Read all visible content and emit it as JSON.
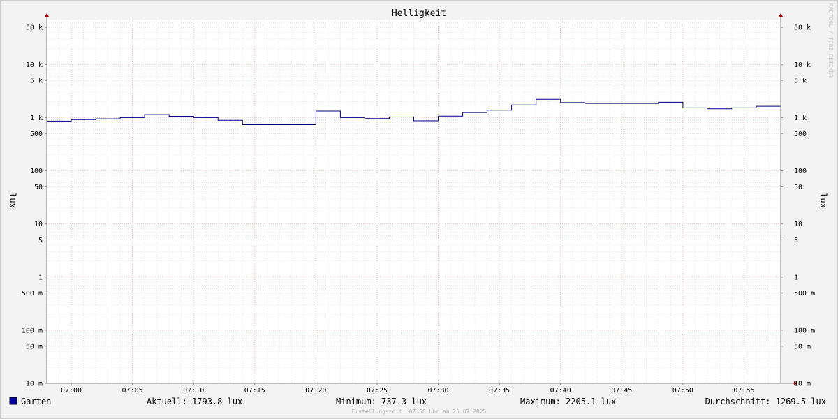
{
  "chart_data": {
    "type": "line",
    "title": "Helligkeit",
    "ylabel": "lux",
    "ylabel_right": "lux",
    "yscale": "log",
    "ylim": [
      0.01,
      70000
    ],
    "xlim": [
      "06:58",
      "07:58"
    ],
    "grid": true,
    "y_ticks": [
      {
        "value": 50000,
        "label": "50 k"
      },
      {
        "value": 10000,
        "label": "10 k"
      },
      {
        "value": 5000,
        "label": "5 k"
      },
      {
        "value": 1000,
        "label": "1 k"
      },
      {
        "value": 500,
        "label": "500"
      },
      {
        "value": 100,
        "label": "100"
      },
      {
        "value": 50,
        "label": "50"
      },
      {
        "value": 10,
        "label": "10"
      },
      {
        "value": 5,
        "label": "5"
      },
      {
        "value": 1,
        "label": "1"
      },
      {
        "value": 0.5,
        "label": "500 m"
      },
      {
        "value": 0.1,
        "label": "100 m"
      },
      {
        "value": 0.05,
        "label": "50 m"
      },
      {
        "value": 0.01,
        "label": "10 m"
      }
    ],
    "x_ticks": [
      "07:00",
      "07:05",
      "07:10",
      "07:15",
      "07:20",
      "07:25",
      "07:30",
      "07:35",
      "07:40",
      "07:45",
      "07:50",
      "07:55"
    ],
    "series": [
      {
        "name": "Garten",
        "color": "#000080",
        "x": [
          "06:58",
          "07:00",
          "07:02",
          "07:04",
          "07:06",
          "07:08",
          "07:10",
          "07:12",
          "07:14",
          "07:16",
          "07:18",
          "07:20",
          "07:22",
          "07:24",
          "07:26",
          "07:28",
          "07:30",
          "07:32",
          "07:34",
          "07:36",
          "07:38",
          "07:40",
          "07:42",
          "07:44",
          "07:46",
          "07:48",
          "07:50",
          "07:52",
          "07:54",
          "07:56"
        ],
        "values": [
          860,
          920,
          950,
          1000,
          1140,
          1060,
          1000,
          890,
          737.3,
          737.3,
          737.3,
          1330,
          1000,
          960,
          1030,
          870,
          1070,
          1250,
          1380,
          1730,
          2205.1,
          1920,
          1850,
          1850,
          1850,
          1950,
          1530,
          1470,
          1530,
          1640
        ],
        "last_value": 1793.8
      }
    ],
    "legend_position": "bottom-left"
  },
  "legend": {
    "series_name": "Garten",
    "swatch_color": "#0000a0",
    "current": "Aktuell: 1793.8 lux",
    "minimum": "Minimum: 737.3 lux",
    "maximum": "Maximum: 2205.1 lux",
    "average": "Durchschnitt: 1269.5 lux"
  },
  "footer": "Erstellungszeit: 07:58 Uhr am 25.07.2025",
  "watermark": "RRDTOOL / TOBI OETIKER",
  "colors": {
    "background": "#f3f3f3",
    "canvas": "#ffffff",
    "major_grid": "#e8a0a0",
    "minor_grid": "#d6d6d6",
    "axis_arrow": "#a00000",
    "line": "#000080"
  }
}
